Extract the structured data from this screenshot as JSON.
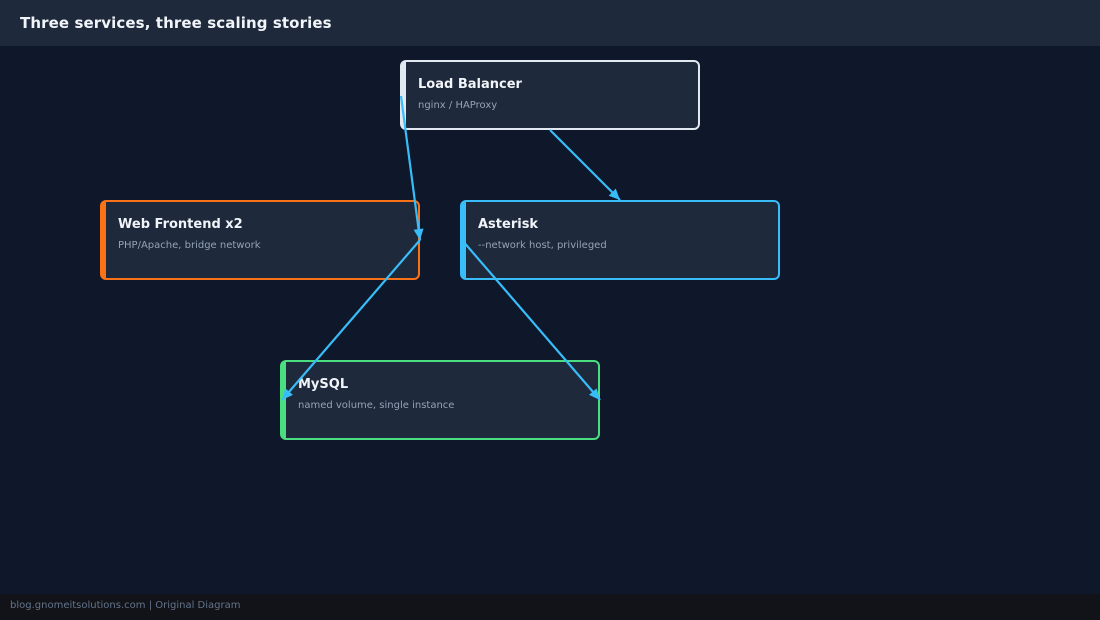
{
  "header": {
    "title": "Three services, three scaling stories"
  },
  "nodes": {
    "load_balancer": {
      "title": "Load Balancer",
      "subtitle": "nginx / HAProxy",
      "color": "#e2e8f0"
    },
    "web_frontend": {
      "title": "Web Frontend x2",
      "subtitle": "PHP/Apache, bridge network",
      "color": "#f97316"
    },
    "asterisk": {
      "title": "Asterisk",
      "subtitle": "--network host, privileged",
      "color": "#38bdf8"
    },
    "mysql": {
      "title": "MySQL",
      "subtitle": "named volume, single instance",
      "color": "#4ade80"
    }
  },
  "edges": [
    {
      "from": "load_balancer",
      "to": "web_frontend"
    },
    {
      "from": "load_balancer",
      "to": "asterisk"
    },
    {
      "from": "web_frontend",
      "to": "mysql"
    },
    {
      "from": "asterisk",
      "to": "mysql"
    }
  ],
  "edge_color": "#38bdf8",
  "footer": {
    "text": "blog.gnomeitsolutions.com | Original Diagram"
  }
}
